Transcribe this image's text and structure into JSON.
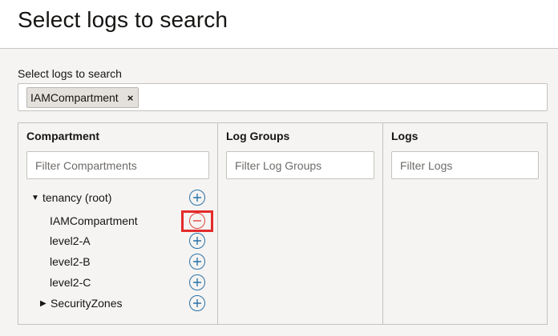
{
  "header": {
    "title": "Select logs to search"
  },
  "selector": {
    "label": "Select logs to search",
    "chips": [
      {
        "label": "IAMCompartment",
        "remove": "×"
      }
    ]
  },
  "columns": {
    "compartment": {
      "title": "Compartment",
      "filter_placeholder": "Filter Compartments"
    },
    "log_groups": {
      "title": "Log Groups",
      "filter_placeholder": "Filter Log Groups"
    },
    "logs": {
      "title": "Logs",
      "filter_placeholder": "Filter Logs"
    }
  },
  "tree": [
    {
      "label": "tenancy (root)",
      "caret": "▼",
      "action": "add-icon"
    },
    {
      "label": "IAMCompartment",
      "caret": "",
      "action": "remove-icon"
    },
    {
      "label": "level2-A",
      "caret": "",
      "action": "add-icon"
    },
    {
      "label": "level2-B",
      "caret": "",
      "action": "add-icon"
    },
    {
      "label": "level2-C",
      "caret": "",
      "action": "add-icon"
    },
    {
      "label": "SecurityZones",
      "caret": "▶",
      "action": "add-icon"
    }
  ],
  "colors": {
    "add_icon": "#2b73a8",
    "remove_icon": "#e0463e",
    "highlight": "#e32b2b"
  }
}
